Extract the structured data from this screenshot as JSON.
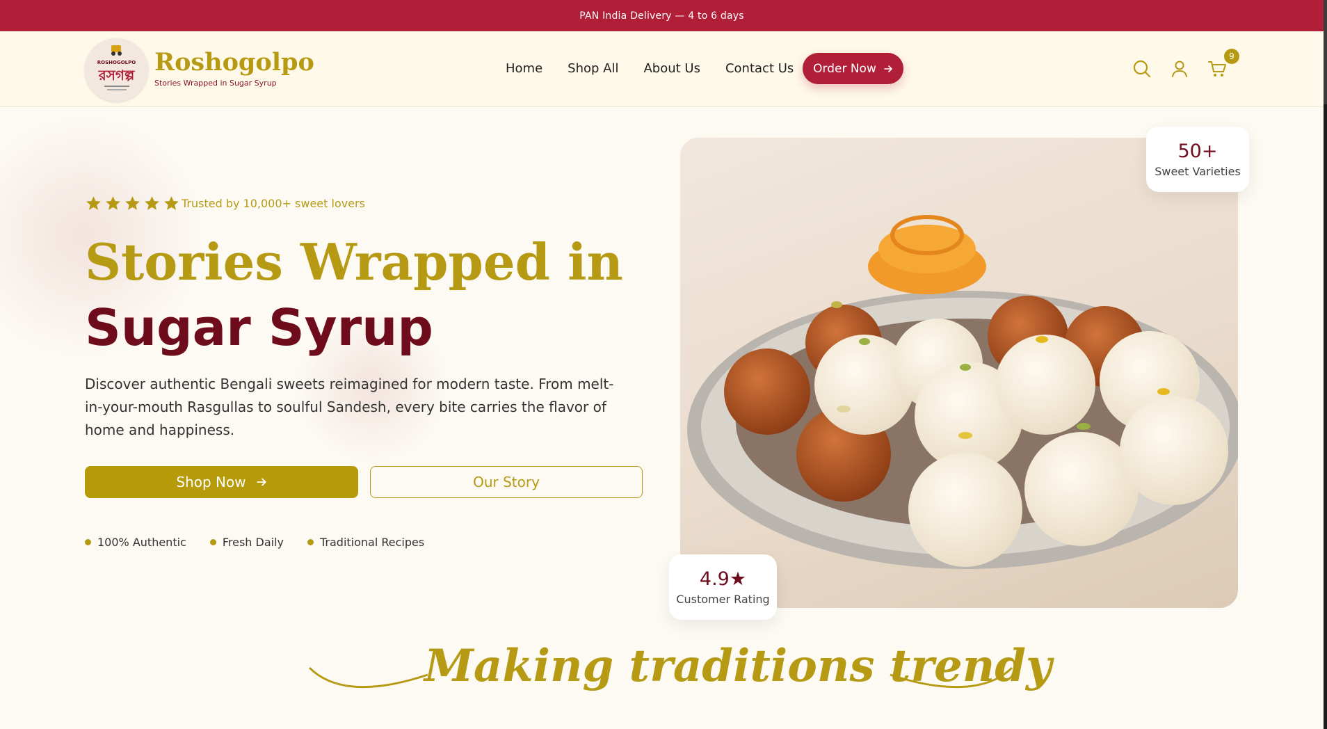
{
  "announcement": {
    "text": "PAN India Delivery — 4 to 6 days"
  },
  "brand": {
    "name": "Roshogolpo",
    "tagline": "Stories Wrapped in Sugar Syrup",
    "logo_title": "ROSHOGOLPO",
    "logo_bengali": "রসগল্প"
  },
  "nav": {
    "items": [
      "Home",
      "Shop All",
      "About Us",
      "Contact Us"
    ],
    "order_label": "Order Now"
  },
  "header_icons": {
    "search": "search-icon",
    "account": "user-icon",
    "cart": "cart-icon",
    "cart_count": "9"
  },
  "hero": {
    "rating_stars": 5,
    "trusted_text": "Trusted by 10,000+ sweet lovers",
    "headline_gold": "Stories Wrapped in",
    "headline_maroon": "Sugar Syrup",
    "description": "Discover authentic Bengali sweets reimagined for modern taste. From melt-in-your-mouth Rasgullas to soulful Sandesh, every bite carries the flavor of home and happiness.",
    "shop_label": "Shop Now",
    "story_label": "Our Story",
    "features": [
      "100% Authentic",
      "Fresh Daily",
      "Traditional Recipes"
    ]
  },
  "stats": {
    "varieties_value": "50+",
    "varieties_label": "Sweet Varieties",
    "rating_value": "4.9★",
    "rating_label": "Customer Rating"
  },
  "section": {
    "tagline": "Making traditions trendy"
  },
  "colors": {
    "primary_red": "#b01e38",
    "gold": "#b69a14",
    "maroon": "#6e0c1c",
    "header_bg": "#fff9ea",
    "page_bg": "#fdfaf4"
  }
}
